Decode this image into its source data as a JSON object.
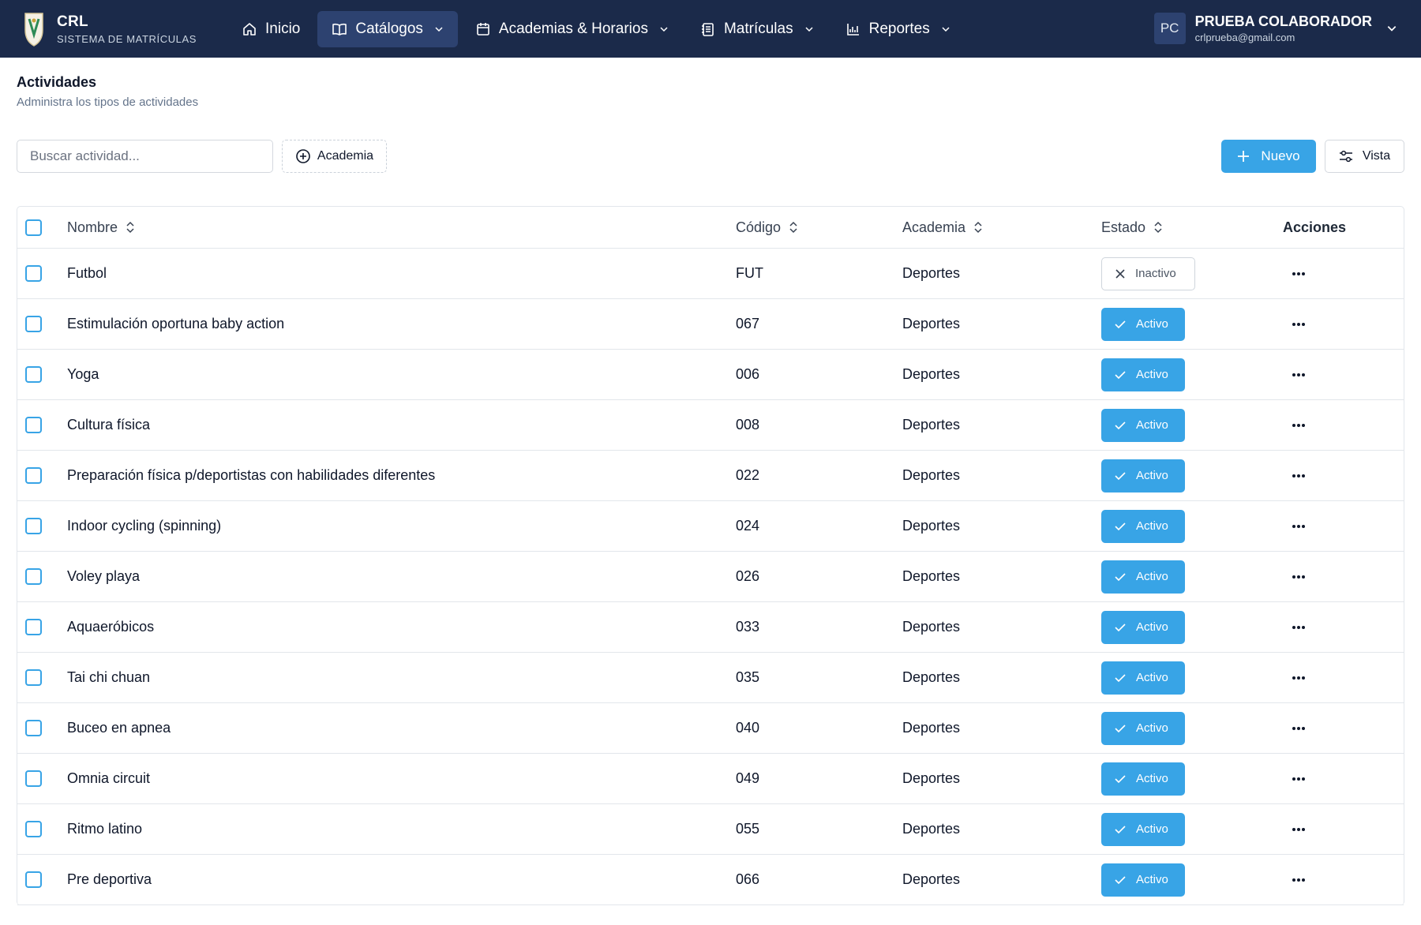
{
  "brand": {
    "title": "CRL",
    "subtitle": "SISTEMA DE MATRÍCULAS"
  },
  "nav": [
    {
      "label": "Inicio",
      "icon": "home-icon",
      "active": false,
      "dropdown": false
    },
    {
      "label": "Catálogos",
      "icon": "book-icon",
      "active": true,
      "dropdown": true
    },
    {
      "label": "Academias & Horarios",
      "icon": "calendar-icon",
      "active": false,
      "dropdown": true
    },
    {
      "label": "Matrículas",
      "icon": "notebook-icon",
      "active": false,
      "dropdown": true
    },
    {
      "label": "Reportes",
      "icon": "chart-icon",
      "active": false,
      "dropdown": true
    }
  ],
  "user": {
    "initials": "PC",
    "name": "PRUEBA COLABORADOR",
    "email": "crlprueba@gmail.com"
  },
  "page": {
    "title": "Actividades",
    "subtitle": "Administra los tipos de actividades"
  },
  "toolbar": {
    "search_placeholder": "Buscar actividad...",
    "filter_label": "Academia",
    "new_label": "Nuevo",
    "view_label": "Vista"
  },
  "table": {
    "headers": {
      "name": "Nombre",
      "code": "Código",
      "academy": "Academia",
      "state": "Estado",
      "actions": "Acciones"
    },
    "rows": [
      {
        "name": "Futbol",
        "code": "FUT",
        "academy": "Deportes",
        "state": "Inactivo",
        "active": false
      },
      {
        "name": "Estimulación oportuna baby action",
        "code": "067",
        "academy": "Deportes",
        "state": "Activo",
        "active": true
      },
      {
        "name": "Yoga",
        "code": "006",
        "academy": "Deportes",
        "state": "Activo",
        "active": true
      },
      {
        "name": "Cultura física",
        "code": "008",
        "academy": "Deportes",
        "state": "Activo",
        "active": true
      },
      {
        "name": "Preparación física p/deportistas con habilidades diferentes",
        "code": "022",
        "academy": "Deportes",
        "state": "Activo",
        "active": true
      },
      {
        "name": "Indoor cycling (spinning)",
        "code": "024",
        "academy": "Deportes",
        "state": "Activo",
        "active": true
      },
      {
        "name": "Voley playa",
        "code": "026",
        "academy": "Deportes",
        "state": "Activo",
        "active": true
      },
      {
        "name": "Aquaeróbicos",
        "code": "033",
        "academy": "Deportes",
        "state": "Activo",
        "active": true
      },
      {
        "name": "Tai chi chuan",
        "code": "035",
        "academy": "Deportes",
        "state": "Activo",
        "active": true
      },
      {
        "name": "Buceo en apnea",
        "code": "040",
        "academy": "Deportes",
        "state": "Activo",
        "active": true
      },
      {
        "name": "Omnia circuit",
        "code": "049",
        "academy": "Deportes",
        "state": "Activo",
        "active": true
      },
      {
        "name": "Ritmo latino",
        "code": "055",
        "academy": "Deportes",
        "state": "Activo",
        "active": true
      },
      {
        "name": "Pre deportiva",
        "code": "066",
        "academy": "Deportes",
        "state": "Activo",
        "active": true
      }
    ]
  },
  "colors": {
    "navbar": "#1b2a4a",
    "accent": "#38a4e6",
    "nav_active": "#2d4270"
  }
}
